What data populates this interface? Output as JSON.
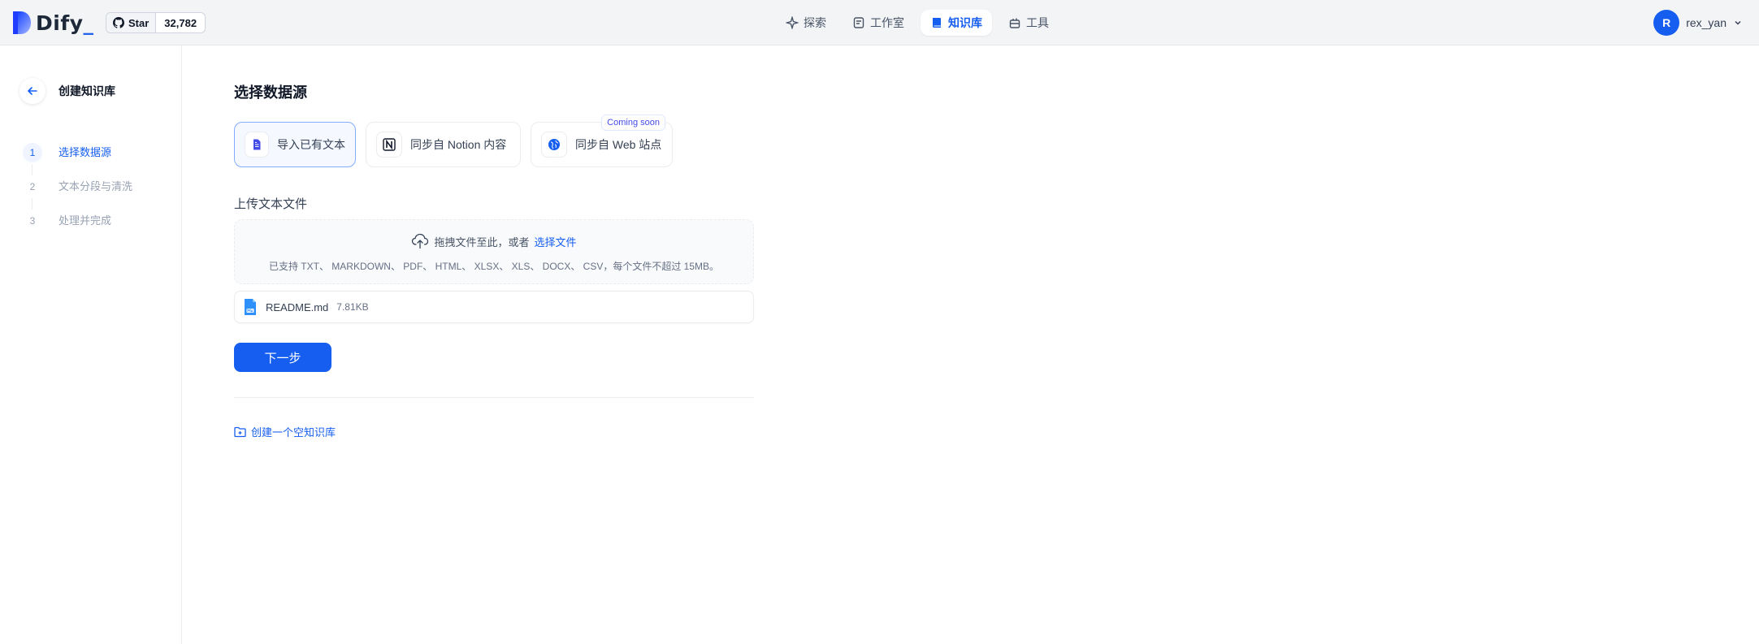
{
  "header": {
    "logo_text": "Dify",
    "logo_suffix": "_",
    "github": {
      "star_label": "Star",
      "count": "32,782"
    },
    "nav": [
      {
        "label": "探索",
        "icon": "compass-icon"
      },
      {
        "label": "工作室",
        "icon": "studio-icon"
      },
      {
        "label": "知识库",
        "icon": "book-icon",
        "active": true
      },
      {
        "label": "工具",
        "icon": "toolbox-icon"
      }
    ],
    "user": {
      "initial": "R",
      "name": "rex_yan"
    }
  },
  "sidebar": {
    "title": "创建知识库",
    "steps": [
      {
        "num": "1",
        "label": "选择数据源",
        "active": true
      },
      {
        "num": "2",
        "label": "文本分段与清洗"
      },
      {
        "num": "3",
        "label": "处理并完成"
      }
    ]
  },
  "main": {
    "title": "选择数据源",
    "sources": [
      {
        "label": "导入已有文本"
      },
      {
        "label": "同步自 Notion 内容"
      },
      {
        "label": "同步自 Web 站点",
        "badge": "Coming soon"
      }
    ],
    "upload_title": "上传文本文件",
    "dropzone": {
      "text": "拖拽文件至此，或者",
      "link": "选择文件",
      "hint": "已支持 TXT、 MARKDOWN、 PDF、 HTML、 XLSX、 XLS、 DOCX、 CSV，每个文件不超过 15MB。"
    },
    "file": {
      "name": "README.md",
      "size": "7.81KB"
    },
    "next_label": "下一步",
    "empty_link": "创建一个空知识库"
  },
  "colors": {
    "primary": "#155eef",
    "background": "#f3f4f6"
  }
}
